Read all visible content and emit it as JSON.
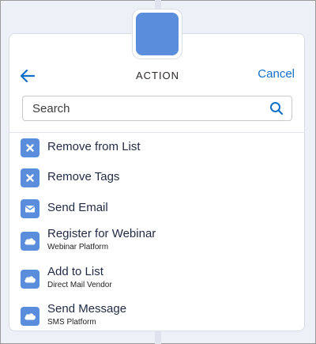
{
  "panel": {
    "title": "ACTION",
    "cancel_label": "Cancel",
    "search": {
      "placeholder": "Search",
      "value": ""
    },
    "items": [
      {
        "label": "Remove from List",
        "sublabel": "",
        "icon": "remove-x-icon"
      },
      {
        "label": "Remove Tags",
        "sublabel": "",
        "icon": "remove-x-icon"
      },
      {
        "label": "Send Email",
        "sublabel": "",
        "icon": "envelope-icon"
      },
      {
        "label": "Register for Webinar",
        "sublabel": "Webinar Platform",
        "icon": "cloud-icon"
      },
      {
        "label": "Add to List",
        "sublabel": "Direct Mail Vendor",
        "icon": "cloud-icon"
      },
      {
        "label": "Send Message",
        "sublabel": "SMS Platform",
        "icon": "cloud-icon"
      }
    ]
  },
  "colors": {
    "accent": "#5a8ddc",
    "link": "#0f6fc9",
    "text": "#1f2a44"
  }
}
